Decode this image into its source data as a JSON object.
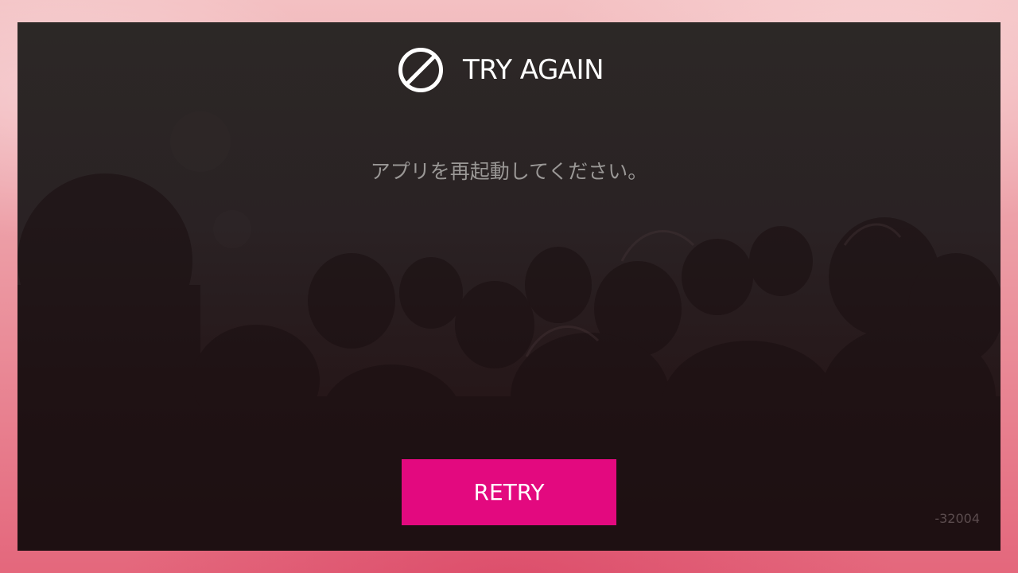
{
  "dialog": {
    "title": "TRY AGAIN",
    "title_icon": "prohibited-icon",
    "message": "アプリを再起動してください。",
    "retry_label": "RETRY",
    "error_code": "-32004"
  },
  "colors": {
    "accent": "#e3097f",
    "dialog_background": "#2a2224",
    "title_text": "#ffffff",
    "message_text": "#9a9896",
    "frame_background": "#ec9aa3"
  }
}
